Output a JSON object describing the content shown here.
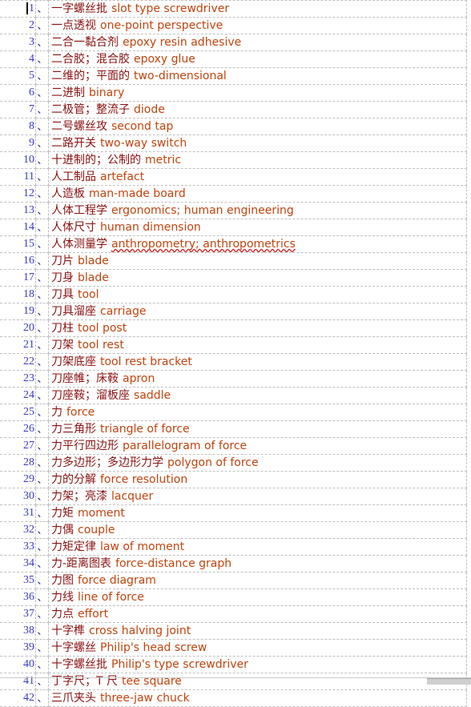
{
  "document": {
    "type": "bilingual-glossary-table",
    "separator_mark": "、",
    "colors": {
      "number": "#3b3bc4",
      "separator": "#1f1f8c",
      "chinese_text": "#8a1010",
      "english_text": "#c1440e",
      "gridline": "#bfbfbf",
      "spell_error_underline": "#d03030",
      "caret": "#000000",
      "scrollbar_thumb": "#cfcfcf"
    },
    "caret": {
      "visible": true,
      "row": 1,
      "position": "before-number"
    },
    "scrollbar": {
      "orientation": "horizontal",
      "visible": true
    }
  },
  "rows": [
    {
      "n": "1",
      "zh": "一字螺丝批",
      "en": "slot type screwdriver",
      "spell_error": false
    },
    {
      "n": "2",
      "zh": "一点透视",
      "en": "one-point perspective",
      "spell_error": false
    },
    {
      "n": "3",
      "zh": "二合一黏合剂",
      "en": "epoxy resin adhesive",
      "spell_error": false
    },
    {
      "n": "4",
      "zh": "二合胶；混合胶",
      "en": "epoxy glue",
      "spell_error": false
    },
    {
      "n": "5",
      "zh": "二维的；平面的",
      "en": "two-dimensional",
      "spell_error": false
    },
    {
      "n": "6",
      "zh": "二进制",
      "en": "binary",
      "spell_error": false
    },
    {
      "n": "7",
      "zh": "二极管；整流子",
      "en": "diode",
      "spell_error": false
    },
    {
      "n": "8",
      "zh": "二号螺丝攻",
      "en": "second tap",
      "spell_error": false
    },
    {
      "n": "9",
      "zh": "二路开关",
      "en": "two-way switch",
      "spell_error": false
    },
    {
      "n": "10",
      "zh": "十进制的；公制的",
      "en": "metric",
      "spell_error": false
    },
    {
      "n": "11",
      "zh": "人工制品",
      "en": "artefact",
      "spell_error": false
    },
    {
      "n": "12",
      "zh": "人造板",
      "en": "man-made board",
      "spell_error": false
    },
    {
      "n": "13",
      "zh": "人体工程学",
      "en": "ergonomics; human engineering",
      "spell_error": false
    },
    {
      "n": "14",
      "zh": "人体尺寸",
      "en": "human dimension",
      "spell_error": false
    },
    {
      "n": "15",
      "zh": "人体测量学",
      "en": "anthropometry; anthropometrics",
      "spell_error": true
    },
    {
      "n": "16",
      "zh": "刀片",
      "en": "blade",
      "spell_error": false
    },
    {
      "n": "17",
      "zh": "刀身",
      "en": "blade",
      "spell_error": false
    },
    {
      "n": "18",
      "zh": "刀具",
      "en": "tool",
      "spell_error": false
    },
    {
      "n": "19",
      "zh": "刀具溜座",
      "en": "carriage",
      "spell_error": false
    },
    {
      "n": "20",
      "zh": "刀柱",
      "en": "tool post",
      "spell_error": false
    },
    {
      "n": "21",
      "zh": "刀架",
      "en": "tool rest",
      "spell_error": false
    },
    {
      "n": "22",
      "zh": "刀架底座",
      "en": "tool rest bracket",
      "spell_error": false
    },
    {
      "n": "23",
      "zh": "刀座帷；床鞍",
      "en": "apron",
      "spell_error": false
    },
    {
      "n": "24",
      "zh": "刀座鞍；溜板座",
      "en": "saddle",
      "spell_error": false
    },
    {
      "n": "25",
      "zh": "力",
      "en": "force",
      "spell_error": false
    },
    {
      "n": "26",
      "zh": "力三角形",
      "en": "triangle of force",
      "spell_error": false
    },
    {
      "n": "27",
      "zh": "力平行四边形",
      "en": "parallelogram of force",
      "spell_error": false
    },
    {
      "n": "28",
      "zh": "力多边形；多边形力学",
      "en": "polygon of force",
      "spell_error": false
    },
    {
      "n": "29",
      "zh": "力的分解",
      "en": "force resolution",
      "spell_error": false
    },
    {
      "n": "30",
      "zh": "力架；亮漆",
      "en": "lacquer",
      "spell_error": false
    },
    {
      "n": "31",
      "zh": "力矩",
      "en": "moment",
      "spell_error": false
    },
    {
      "n": "32",
      "zh": "力偶",
      "en": "couple",
      "spell_error": false
    },
    {
      "n": "33",
      "zh": "力矩定律",
      "en": "law of moment",
      "spell_error": false
    },
    {
      "n": "34",
      "zh": "力-距离图表",
      "en": "force-distance graph",
      "spell_error": false
    },
    {
      "n": "35",
      "zh": "力图",
      "en": "force diagram",
      "spell_error": false
    },
    {
      "n": "36",
      "zh": "力线",
      "en": "line of force",
      "spell_error": false
    },
    {
      "n": "37",
      "zh": "力点",
      "en": "effort",
      "spell_error": false
    },
    {
      "n": "38",
      "zh": "十字榫",
      "en": "cross halving joint",
      "spell_error": false
    },
    {
      "n": "39",
      "zh": "十字螺丝",
      "en": "Philip's head screw",
      "spell_error": false
    },
    {
      "n": "40",
      "zh": "十字螺丝批",
      "en": "Philip's type screwdriver",
      "spell_error": false
    },
    {
      "n": "41",
      "zh": "丁字尺；T 尺",
      "en": "tee square",
      "spell_error": false
    },
    {
      "n": "42",
      "zh": "三爪夹头",
      "en": "three-jaw chuck",
      "spell_error": false
    }
  ]
}
